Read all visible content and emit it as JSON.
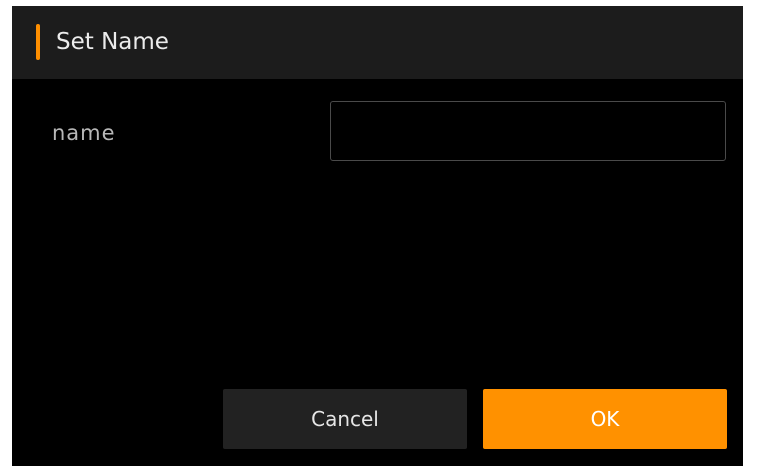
{
  "dialog": {
    "title": "Set Name",
    "accent_color": "#ff9100"
  },
  "form": {
    "name_label": "name",
    "name_value": ""
  },
  "buttons": {
    "cancel_label": "Cancel",
    "ok_label": "OK"
  }
}
